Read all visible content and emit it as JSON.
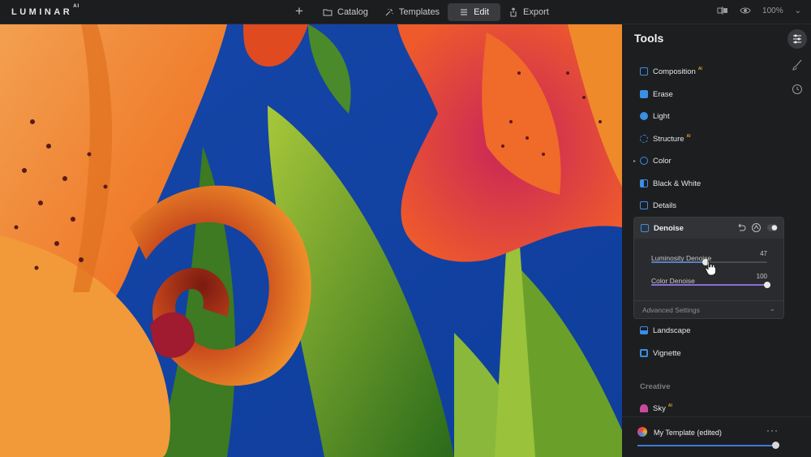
{
  "app": {
    "logo": "LUMINAR",
    "logo_sup": "AI"
  },
  "nav": {
    "add_label": "+",
    "tabs": [
      {
        "label": "Catalog",
        "icon": "folder-icon"
      },
      {
        "label": "Templates",
        "icon": "sparkle-icon"
      },
      {
        "label": "Edit",
        "icon": "sliders-icon",
        "active": true
      },
      {
        "label": "Export",
        "icon": "share-icon"
      }
    ],
    "zoom": "100%"
  },
  "panel": {
    "title": "Tools",
    "tools": [
      {
        "label": "Composition",
        "ai": "AI",
        "color": "#3a8ee6"
      },
      {
        "label": "Erase",
        "ai": "",
        "color": "#3a8ee6"
      },
      {
        "label": "Light",
        "ai": "",
        "color": "#3a8ee6"
      },
      {
        "label": "Structure",
        "ai": "AI",
        "color": "#3a8ee6"
      },
      {
        "label": "Color",
        "ai": "",
        "color": "#3a8ee6"
      },
      {
        "label": "Black & White",
        "ai": "",
        "color": "#3a8ee6"
      },
      {
        "label": "Details",
        "ai": "",
        "color": "#3a8ee6"
      }
    ],
    "denoise": {
      "title": "Denoise",
      "sliders": [
        {
          "label": "Luminosity Denoise",
          "value": "47",
          "fraction": 0.47,
          "fill": "#5a7fc4"
        },
        {
          "label": "Color Denoise",
          "value": "100",
          "fraction": 1.0,
          "fill": "#8a6fd6"
        }
      ],
      "advanced_label": "Advanced Settings"
    },
    "tools_after": [
      {
        "label": "Landscape",
        "ai": "",
        "color": "#3a8ee6"
      },
      {
        "label": "Vignette",
        "ai": "",
        "color": "#3a8ee6"
      }
    ],
    "section_creative": "Creative",
    "creative_tools": [
      {
        "label": "Sky",
        "ai": "AI",
        "color": "#c84a9a"
      }
    ],
    "template": {
      "name": "My Template (edited)",
      "more": "···",
      "fraction": 1.0
    }
  },
  "colors": {
    "accent": "#3a8ee6",
    "sky_blue": "#1546a8",
    "petal_orange": "#ef8a2a",
    "petal_red": "#d83a2c"
  }
}
